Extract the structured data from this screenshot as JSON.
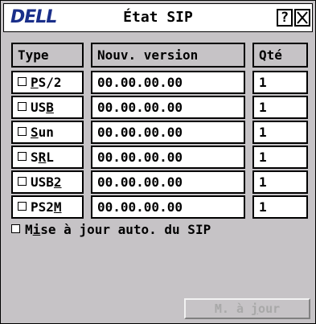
{
  "window": {
    "logo": "DELL",
    "title": "État SIP",
    "help_label": "?",
    "close_label": "X"
  },
  "table": {
    "headers": [
      "Type",
      "Nouv. version",
      "Qté"
    ],
    "rows": [
      {
        "type_pre": "",
        "type_ul": "P",
        "type_post": "S/2",
        "version": "00.00.00.00",
        "qty": "1"
      },
      {
        "type_pre": "US",
        "type_ul": "B",
        "type_post": "",
        "version": "00.00.00.00",
        "qty": "1"
      },
      {
        "type_pre": "",
        "type_ul": "S",
        "type_post": "un",
        "version": "00.00.00.00",
        "qty": "1"
      },
      {
        "type_pre": "S",
        "type_ul": "R",
        "type_post": "L",
        "version": "00.00.00.00",
        "qty": "1"
      },
      {
        "type_pre": "USB",
        "type_ul": "2",
        "type_post": "",
        "version": "00.00.00.00",
        "qty": "1"
      },
      {
        "type_pre": "PS2",
        "type_ul": "M",
        "type_post": "",
        "version": "00.00.00.00",
        "qty": "1"
      }
    ]
  },
  "auto_update": {
    "label_pre": "M",
    "label_ul": "i",
    "label_post": "se à jour auto. du SIP",
    "checked": false
  },
  "update_button": {
    "label_pre": "M. à ",
    "label_ul": "j",
    "label_post": "our",
    "enabled": false
  }
}
